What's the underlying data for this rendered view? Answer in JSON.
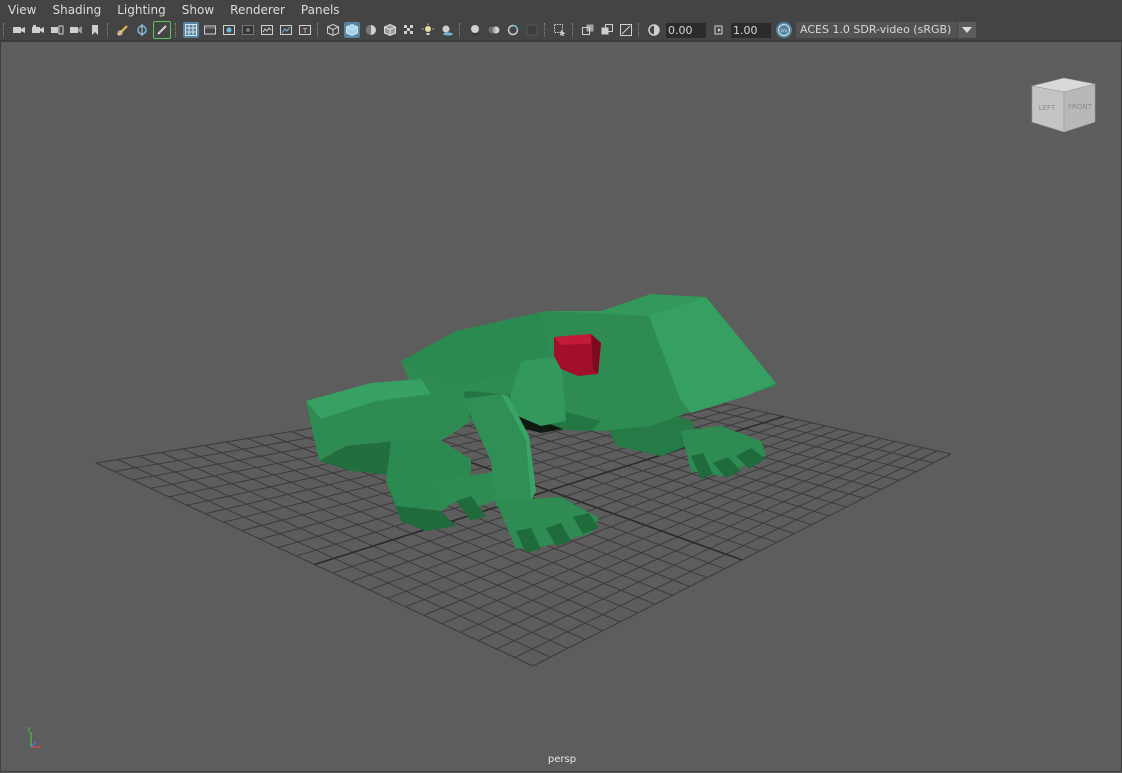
{
  "menubar": {
    "items": [
      "View",
      "Shading",
      "Lighting",
      "Show",
      "Renderer",
      "Panels"
    ]
  },
  "toolbar": {
    "exposure_value": "0.00",
    "gamma_value": "1.00",
    "colorspace_label": "ACES 1.0 SDR-video (sRGB)",
    "icons": [
      "camera-icon",
      "camera-attributes-icon",
      "image-plane-icon",
      "bookmark-icon",
      "film-gate-icon",
      "grid-icon",
      "wireframe-cube-icon",
      "smooth-shade-icon",
      "textured-icon",
      "lights-icon",
      "shadows-icon",
      "xray-icon",
      "isolate-icon"
    ]
  },
  "viewport": {
    "camera_name": "persp",
    "viewcube": {
      "left_label": "LEFT",
      "front_label": "FRONT"
    },
    "axis": {
      "y_label": "y"
    },
    "colors": {
      "background": "#5d5d5d",
      "grid": "#3a3a3a",
      "frog_green": "#2e8c52",
      "eye_red": "#a10f2a"
    }
  }
}
